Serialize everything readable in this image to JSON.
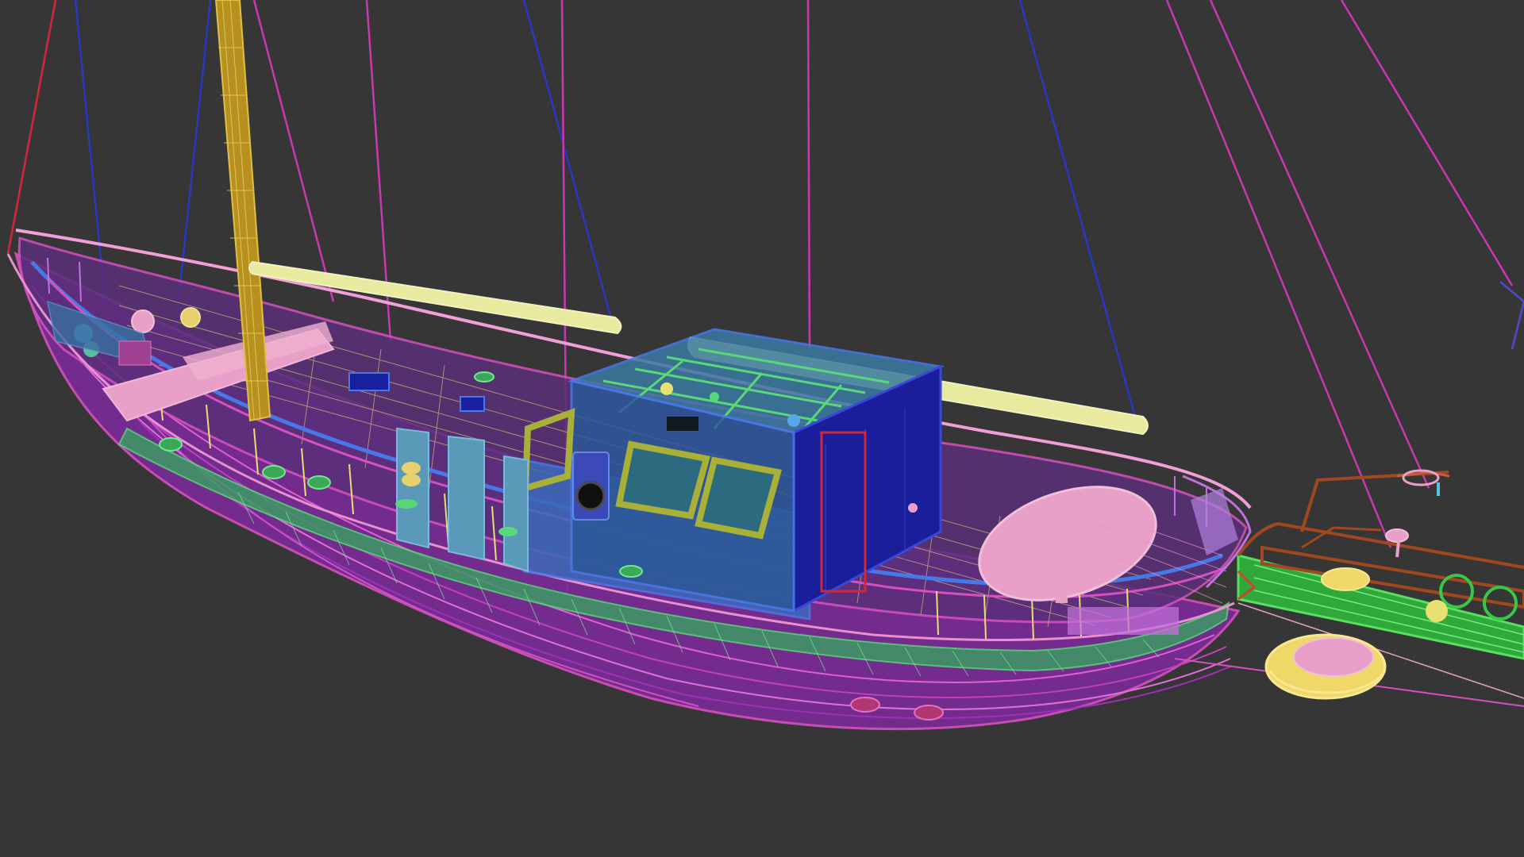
{
  "viewport": {
    "background": "#363636",
    "render_mode": "wireframe",
    "subject": "sailing-yacht-model"
  },
  "palette": {
    "mast": "#c8a030",
    "boom": "#e8eaa0",
    "rigging_magenta": "#c838b0",
    "rigging_blue": "#2838c0",
    "rigging_red": "#d02838",
    "hull_purple": "#a038c8",
    "hull_magenta": "#d850c0",
    "deck_green": "#58d878",
    "deck_yellow": "#e8e070",
    "cabin_blue": "#4878e8",
    "cabin_navy": "#1820a0",
    "cabin_teal": "#3890a0",
    "window_olive": "#a8b038",
    "cushion_pink": "#e8a0c8",
    "rail_pink": "#f0a0d8",
    "bowsprit_green": "#38c848",
    "bowsprit_brown": "#a04820",
    "dinghy_yellow": "#f0d868"
  }
}
